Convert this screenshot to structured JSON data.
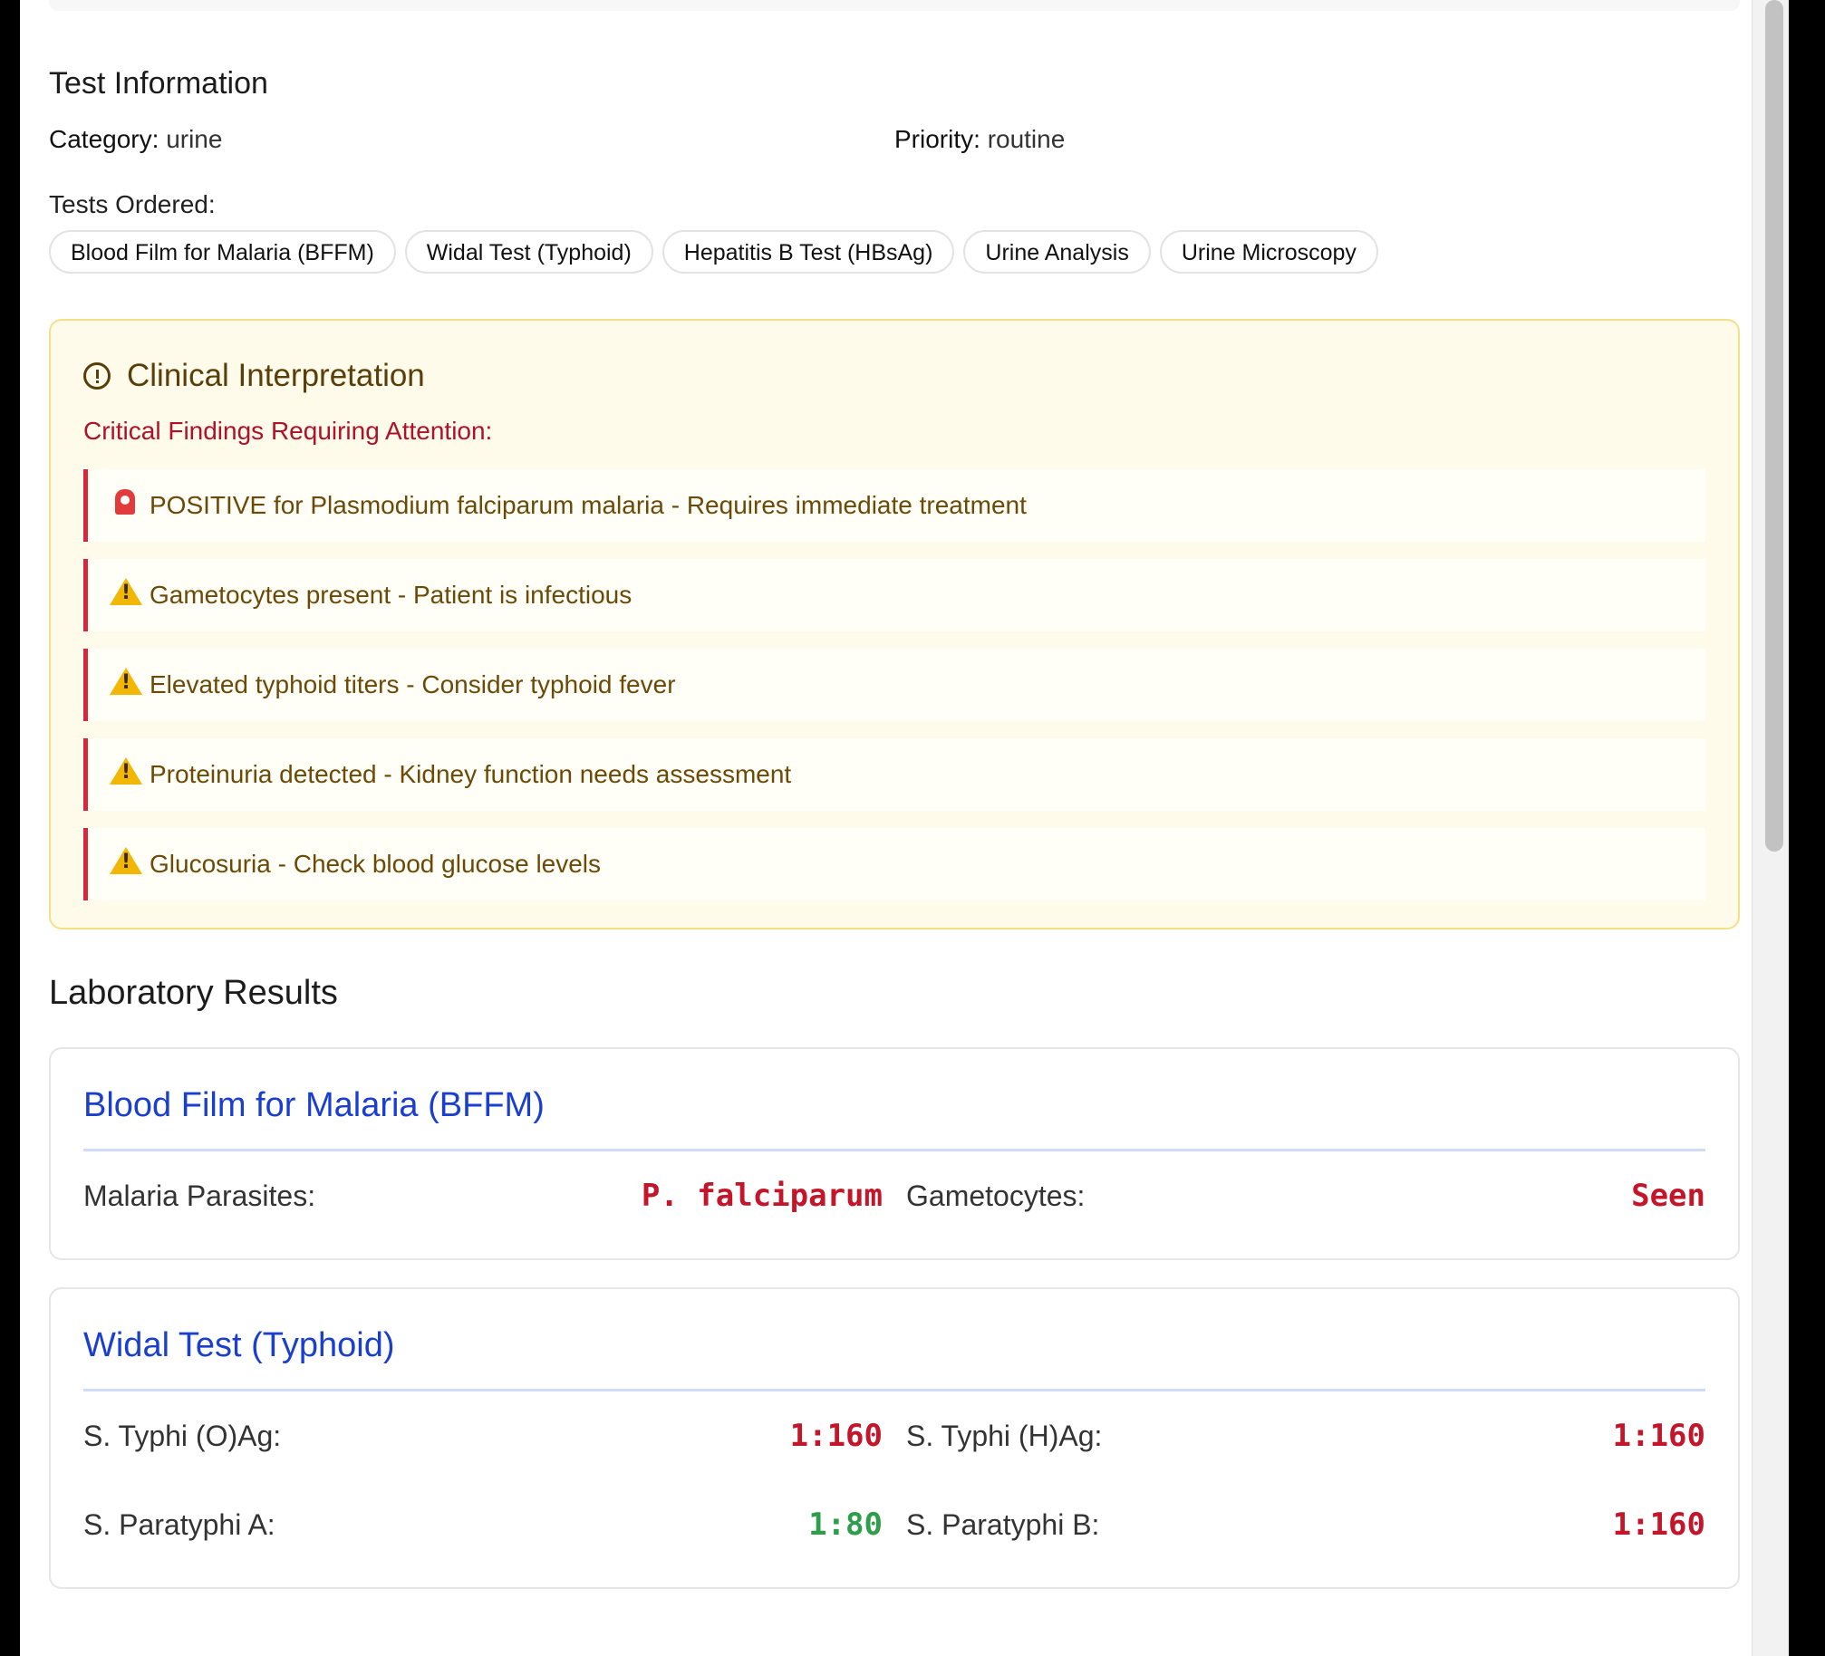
{
  "test_information": {
    "title": "Test Information",
    "category_key": "Category:",
    "category_value": "urine",
    "priority_key": "Priority:",
    "priority_value": "routine",
    "tests_ordered_label": "Tests Ordered:",
    "tests_ordered": [
      "Blood Film for Malaria (BFFM)",
      "Widal Test (Typhoid)",
      "Hepatitis B Test (HBsAg)",
      "Urine Analysis",
      "Urine Microscopy"
    ]
  },
  "clinical_interpretation": {
    "title": "Clinical Interpretation",
    "critical_title": "Critical Findings Requiring Attention:",
    "findings": [
      {
        "icon": "siren-icon",
        "text": "POSITIVE for Plasmodium falciparum malaria - Requires immediate treatment"
      },
      {
        "icon": "warning-icon",
        "text": "Gametocytes present - Patient is infectious"
      },
      {
        "icon": "warning-icon",
        "text": "Elevated typhoid titers - Consider typhoid fever"
      },
      {
        "icon": "warning-icon",
        "text": "Proteinuria detected - Kidney function needs assessment"
      },
      {
        "icon": "warning-icon",
        "text": "Glucosuria - Check blood glucose levels"
      }
    ],
    "colors": {
      "background": "#fffbea",
      "border": "#f5e08a",
      "critical": "#b0102a",
      "finding_bar": "#d7263d"
    }
  },
  "laboratory_results": {
    "title": "Laboratory Results",
    "cards": [
      {
        "title": "Blood Film for Malaria (BFFM)",
        "items": [
          {
            "label": "Malaria Parasites:",
            "value": "P. falciparum",
            "status": "abnormal"
          },
          {
            "label": "Gametocytes:",
            "value": "Seen",
            "status": "abnormal"
          }
        ]
      },
      {
        "title": "Widal Test (Typhoid)",
        "items": [
          {
            "label": "S. Typhi (O)Ag:",
            "value": "1:160",
            "status": "abnormal"
          },
          {
            "label": "S. Typhi (H)Ag:",
            "value": "1:160",
            "status": "abnormal"
          },
          {
            "label": "S. Paratyphi A:",
            "value": "1:80",
            "status": "normal"
          },
          {
            "label": "S. Paratyphi B:",
            "value": "1:160",
            "status": "abnormal"
          }
        ]
      }
    ],
    "colors": {
      "abnormal": "#c4162a",
      "normal": "#2e9e4a",
      "card_title": "#1a3fcf"
    }
  }
}
